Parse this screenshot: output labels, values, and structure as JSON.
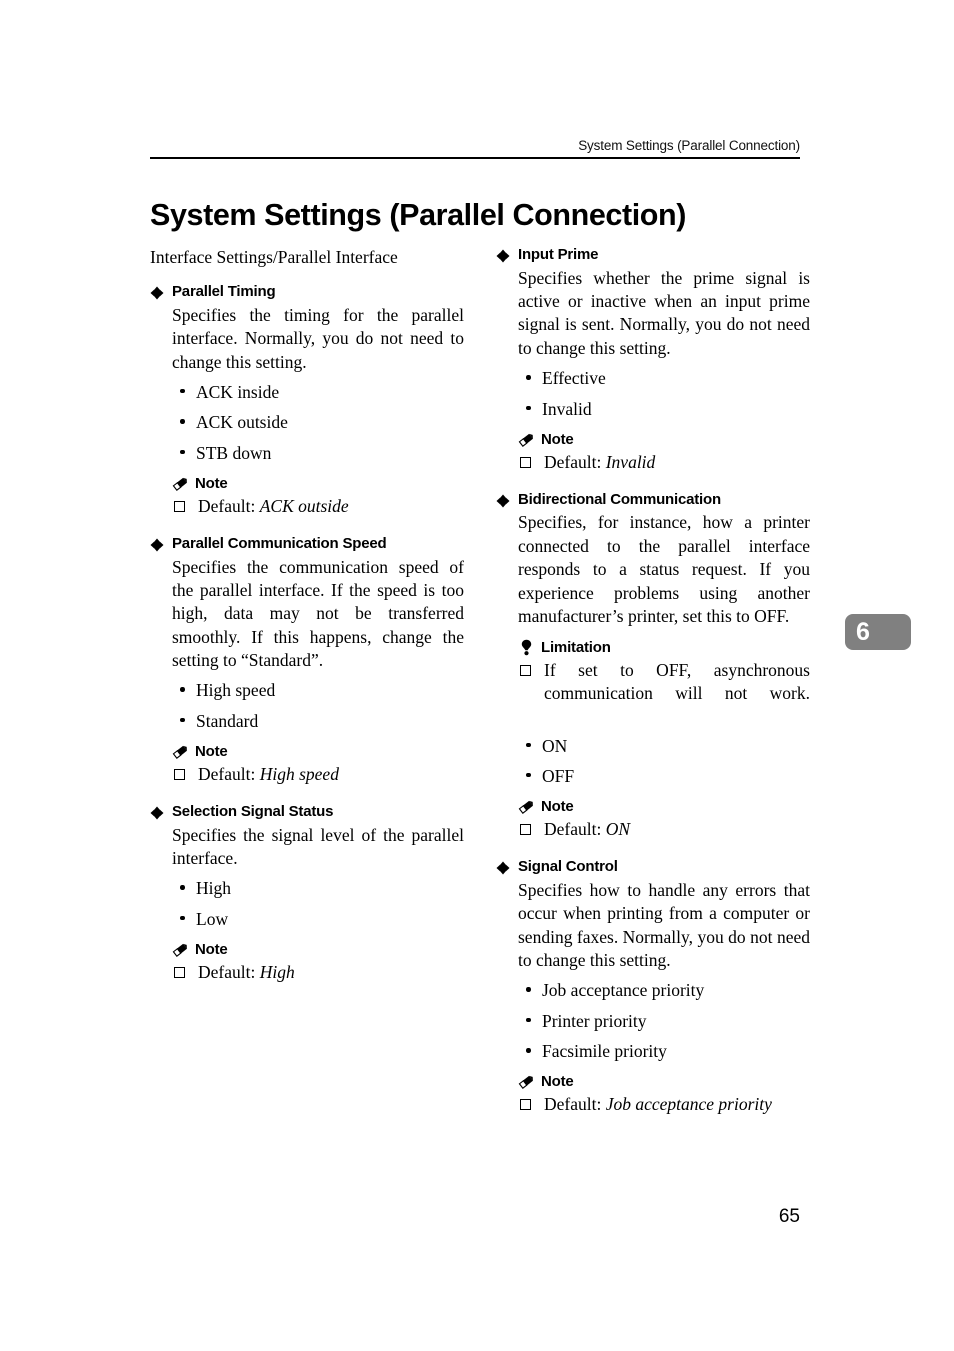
{
  "header": {
    "running_title": "System Settings (Parallel Connection)"
  },
  "title": "System Settings (Parallel Connection)",
  "intro": "Interface Settings/Parallel Interface",
  "icons": {
    "section": "diamond-bullet-icon",
    "note": "pencil-icon",
    "limitation": "lightbulb-icon",
    "default_marker": "open-square-icon"
  },
  "labels": {
    "note": "Note",
    "limitation": "Limitation",
    "default_prefix": "Default: "
  },
  "left_column": {
    "sections": [
      {
        "heading": "Parallel Timing",
        "body": "Specifies the timing for the parallel interface. Normally, you do not need to change this setting.",
        "options": [
          "ACK inside",
          "ACK outside",
          "STB down"
        ],
        "note": {
          "label": "Note",
          "default_value": "ACK outside"
        }
      },
      {
        "heading": "Parallel Communication Speed",
        "body": "Specifies the communication speed of the parallel interface. If the speed is too high, data may not be transferred smoothly. If this happens, change the setting to “Standard”.",
        "options": [
          "High speed",
          "Standard"
        ],
        "note": {
          "label": "Note",
          "default_value": "High speed"
        }
      },
      {
        "heading": "Selection Signal Status",
        "body": "Specifies the signal level of the parallel interface.",
        "options": [
          "High",
          "Low"
        ],
        "note": {
          "label": "Note",
          "default_value": "High"
        }
      }
    ]
  },
  "right_column": {
    "sections": [
      {
        "heading": "Input Prime",
        "body": "Specifies whether the prime signal is active or inactive when an input prime signal is sent. Normally, you do not need to change this setting.",
        "options": [
          "Effective",
          "Invalid"
        ],
        "note": {
          "label": "Note",
          "default_value": "Invalid"
        }
      },
      {
        "heading": "Bidirectional Communication",
        "body": "Specifies, for instance, how a printer connected to the parallel interface responds to a status request. If you experience problems using another manufacturer’s printer, set this to OFF.",
        "limitation": {
          "label": "Limitation",
          "text": "If set to OFF, asynchronous communication will not work."
        },
        "options": [
          "ON",
          "OFF"
        ],
        "note": {
          "label": "Note",
          "default_value": "ON"
        }
      },
      {
        "heading": "Signal Control",
        "body": "Specifies how to handle any errors that occur when printing from a computer or sending faxes. Normally, you do not need to change this setting.",
        "options": [
          "Job acceptance priority",
          "Printer priority",
          "Facsimile priority"
        ],
        "note": {
          "label": "Note",
          "default_value": "Job acceptance priority"
        }
      }
    ]
  },
  "chapter_tab": {
    "number": "6",
    "color": "#808080"
  },
  "folio": "65"
}
